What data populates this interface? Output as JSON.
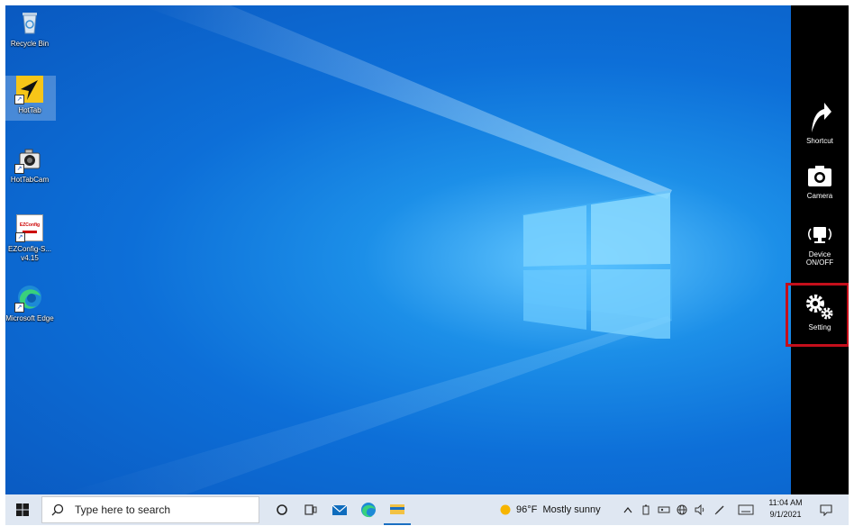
{
  "desktop": {
    "icons": [
      {
        "name": "recycle-bin",
        "label": "Recycle Bin"
      },
      {
        "name": "hottab",
        "label": "HotTab"
      },
      {
        "name": "hottabcam",
        "label": "HotTabCam"
      },
      {
        "name": "ezconfig",
        "label": "EZConfig-S... v4.15",
        "tile_text": "EZConfig"
      },
      {
        "name": "microsoft-edge",
        "label": "Microsoft Edge"
      }
    ]
  },
  "side_panel": {
    "items": [
      {
        "label": "Shortcut",
        "icon": "shortcut-arrow-icon"
      },
      {
        "label": "Camera",
        "icon": "camera-icon"
      },
      {
        "label": "Device ON/OFF",
        "icon": "device-wireless-icon"
      },
      {
        "label": "Setting",
        "icon": "gears-icon"
      }
    ],
    "highlighted": "Setting",
    "highlight_color": "#c40f1b"
  },
  "taskbar": {
    "search_placeholder": "Type here to search",
    "weather": "96°F  Mostly sunny",
    "clock_time": "11:04 AM",
    "clock_date": "9/1/2021",
    "pinned": [
      "cortana-icon",
      "task-view-icon",
      "mail-icon",
      "edge-icon",
      "file-explorer-icon"
    ],
    "tray": [
      "chevron-up-icon",
      "battery-icon",
      "network-icon",
      "globe-icon",
      "volume-icon",
      "pen-icon",
      "keyboard-icon"
    ]
  }
}
